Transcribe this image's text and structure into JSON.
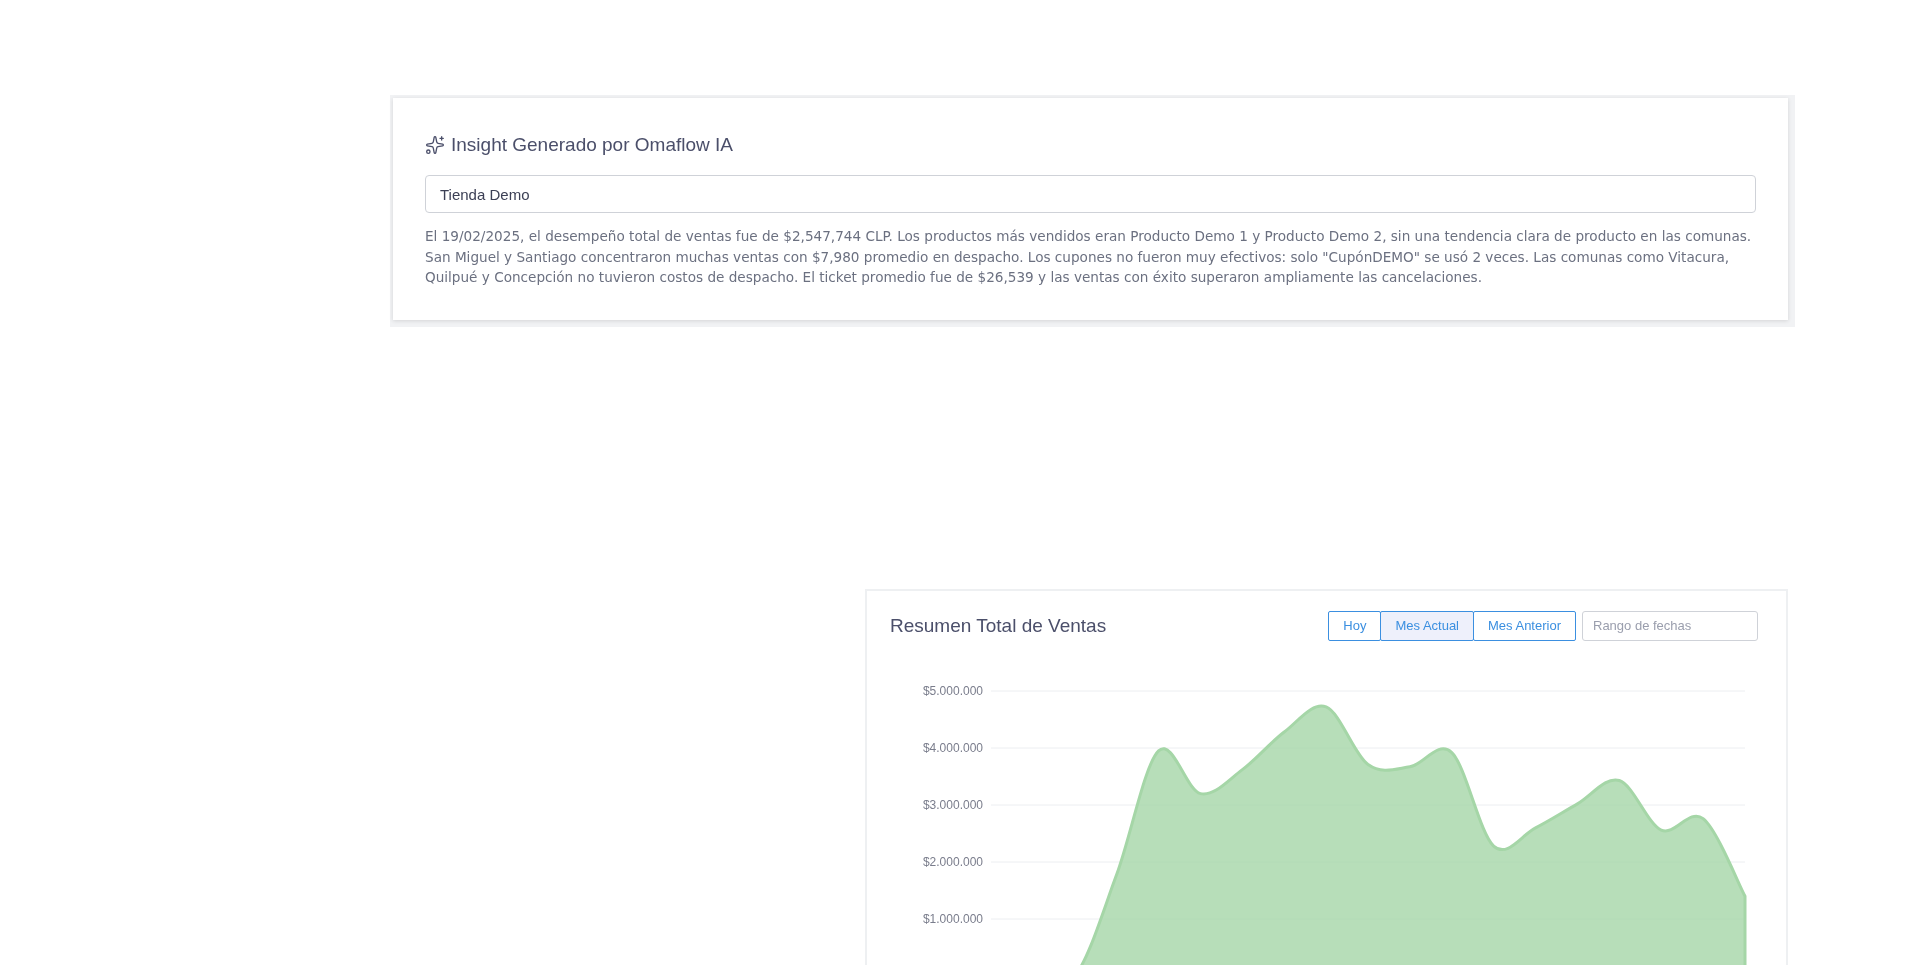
{
  "insight": {
    "title": "Insight Generado por Omaflow IA",
    "store": "Tienda Demo",
    "text": "El 19/02/2025, el desempeño total de ventas fue de $2,547,744 CLP. Los productos más vendidos eran Producto Demo 1 y Producto Demo 2, sin una tendencia clara de producto en las comunas. San Miguel y Santiago concentraron muchas ventas con $7,980 promedio en despacho. Los cupones no fueron muy efectivos: solo \"CupónDEMO\" se usó 2 veces. Las comunas como Vitacura, Quilpué y Concepción no tuvieron costos de despacho. El ticket promedio fue de $26,539 y las ventas con éxito superaron ampliamente las cancelaciones."
  },
  "sales_summary": {
    "title": "Resumen Total de Ventas",
    "ranges": [
      {
        "label": "Hoy",
        "selected": false
      },
      {
        "label": "Mes Actual",
        "selected": true
      },
      {
        "label": "Mes Anterior",
        "selected": false
      }
    ],
    "date_range": {
      "placeholder": "Rango de fechas"
    },
    "chart_data": {
      "type": "area",
      "grid": true,
      "ylim": [
        0,
        5000000
      ],
      "yticks": [
        {
          "value": 1000000,
          "label": "$1.000.000"
        },
        {
          "value": 2000000,
          "label": "$2.000.000"
        },
        {
          "value": 3000000,
          "label": "$3.000.000"
        },
        {
          "value": 4000000,
          "label": "$4.000.000"
        },
        {
          "value": 5000000,
          "label": "$5.000.000"
        }
      ],
      "series": [
        {
          "color": "#a5d6a7",
          "values": [
            0,
            0,
            0,
            1780000,
            3950000,
            3200000,
            3620000,
            4280000,
            4720000,
            3710000,
            3670000,
            3920000,
            2280000,
            2600000,
            3020000,
            3430000,
            2560000,
            2760000,
            1400000
          ]
        }
      ]
    }
  }
}
